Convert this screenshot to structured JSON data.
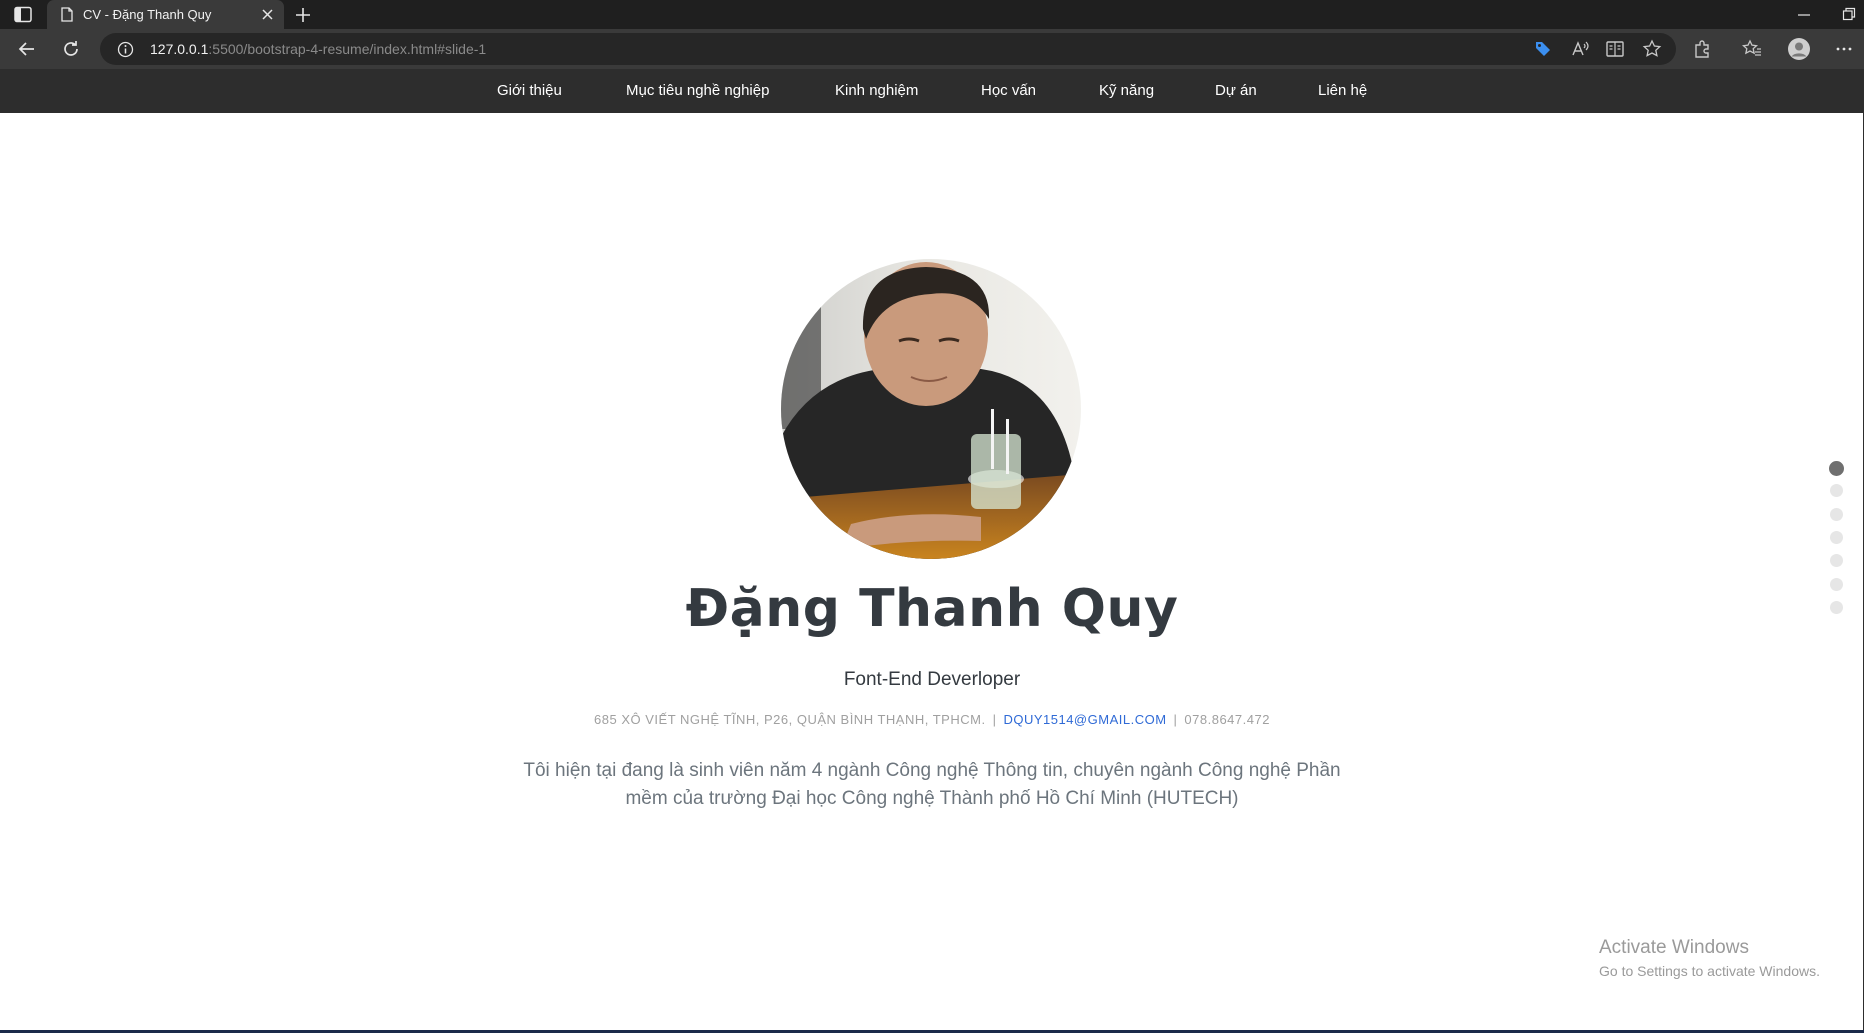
{
  "browser": {
    "tab_title": "CV - Đặng Thanh Quy",
    "url_host": "127.0.0.1",
    "url_rest": ":5500/bootstrap-4-resume/index.html#slide-1"
  },
  "nav": {
    "items": [
      "Giới thiệu",
      "Mục tiêu nghề nghiệp",
      "Kinh nghiệm",
      "Học vấn",
      "Kỹ năng",
      "Dự án",
      "Liên hệ"
    ]
  },
  "profile": {
    "name": "Đặng Thanh Quy",
    "role": "Font-End Deverloper",
    "address": "685 XÔ VIẾT NGHỆ TĨNH, P26, QUẬN BÌNH THẠNH, TPHCM.",
    "email": "DQUY1514@GMAIL.COM",
    "phone": "078.8647.472",
    "separator": "|",
    "bio": "Tôi hiện tại đang là sinh viên năm 4 ngành Công nghệ Thông tin, chuyên ngành Công nghệ Phần mềm của trường Đại học Công nghệ Thành phố Hồ Chí Minh (HUTECH)"
  },
  "slides": {
    "count": 7,
    "active": 1
  },
  "watermark": {
    "line1": "Activate Windows",
    "line2": "Go to Settings to activate Windows."
  },
  "colors": {
    "nav_bg": "#2d2d2d",
    "email": "#2f6ad6",
    "name": "#343a40",
    "active_dot": "#6f6f6f"
  },
  "icons": [
    "sidebar-icon",
    "document-icon",
    "close-icon",
    "plus-icon",
    "back-icon",
    "reload-icon",
    "info-icon",
    "tag-icon",
    "read-aloud-icon",
    "immersive-reader-icon",
    "favorite-add-icon",
    "extensions-icon",
    "favorites-icon",
    "profile-icon",
    "more-icon"
  ]
}
